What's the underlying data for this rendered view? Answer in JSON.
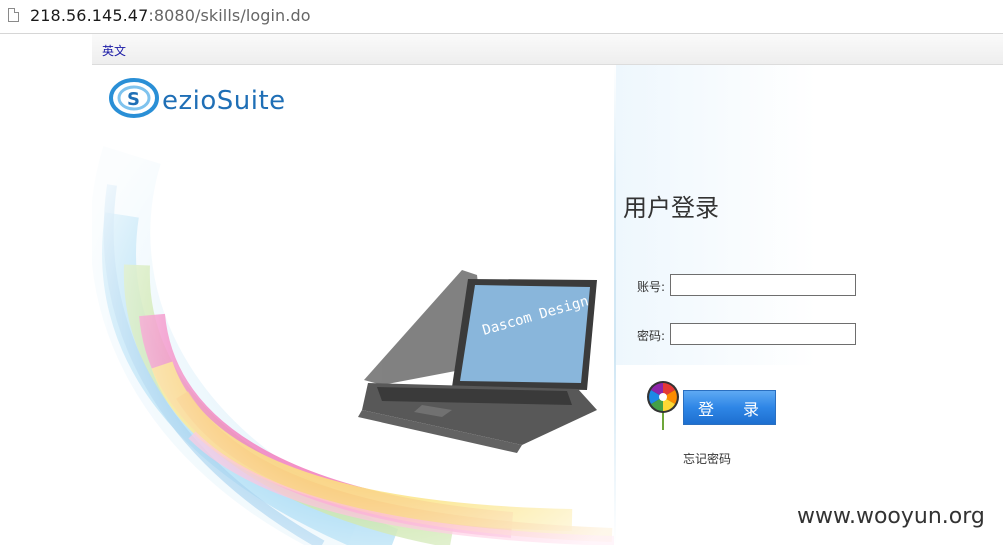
{
  "browser": {
    "url_host": "218.56.145.47",
    "url_rest": ":8080/skills/login.do"
  },
  "topbar": {
    "language_link": "英文"
  },
  "brand": {
    "logo_text": "ezioSuite"
  },
  "laptop": {
    "screen_text": "Dascom Design"
  },
  "login": {
    "title": "用户登录",
    "account_label": "账号:",
    "account_value": "",
    "password_label": "密码:",
    "password_value": "",
    "submit_label": "登 录",
    "forgot_label": "忘记密码"
  },
  "watermark": "www.wooyun.org"
}
